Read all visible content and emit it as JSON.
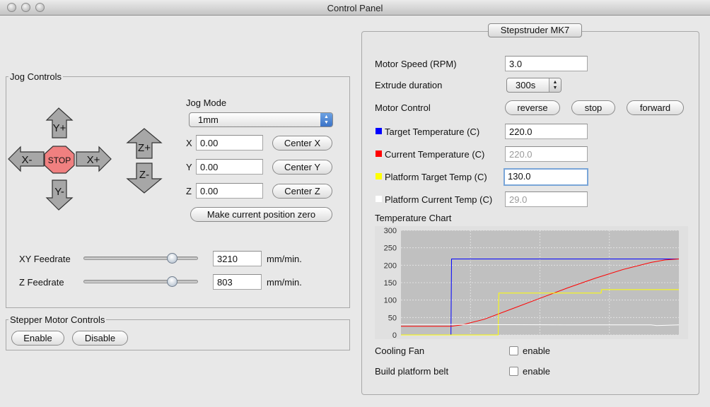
{
  "window": {
    "title": "Control Panel"
  },
  "jog": {
    "group_label": "Jog Controls",
    "buttons": {
      "y_plus": "Y+",
      "y_minus": "Y-",
      "x_plus": "X+",
      "x_minus": "X-",
      "stop": "STOP",
      "z_plus": "Z+",
      "z_minus": "Z-"
    },
    "mode_label": "Jog Mode",
    "mode_value": "1mm",
    "axes": [
      {
        "label": "X",
        "value": "0.00",
        "center": "Center X"
      },
      {
        "label": "Y",
        "value": "0.00",
        "center": "Center Y"
      },
      {
        "label": "Z",
        "value": "0.00",
        "center": "Center Z"
      }
    ],
    "make_zero": "Make current position zero",
    "xy_feed": {
      "label": "XY Feedrate",
      "value": "3210",
      "unit": "mm/min.",
      "level": 0.8
    },
    "z_feed": {
      "label": "Z Feedrate",
      "value": "803",
      "unit": "mm/min.",
      "level": 0.8
    }
  },
  "stepper": {
    "group_label": "Stepper Motor Controls",
    "enable": "Enable",
    "disable": "Disable"
  },
  "extruder": {
    "tab": "Stepstruder MK7",
    "motor_speed": {
      "label": "Motor Speed (RPM)",
      "value": "3.0"
    },
    "extrude_duration": {
      "label": "Extrude duration",
      "value": "300s"
    },
    "motor_control": {
      "label": "Motor Control",
      "reverse": "reverse",
      "stop": "stop",
      "forward": "forward"
    },
    "target_temp": {
      "label": "Target Temperature (C)",
      "value": "220.0",
      "color": "#0000ff"
    },
    "current_temp": {
      "label": "Current Temperature (C)",
      "value": "220.0",
      "color": "#ff0000"
    },
    "platform_target": {
      "label": "Platform Target Temp (C)",
      "value": "130.0",
      "color": "#ffff00"
    },
    "platform_current": {
      "label": "Platform Current Temp (C)",
      "value": "29.0",
      "color": "#ffffff"
    },
    "chart_label": "Temperature Chart",
    "cooling_fan": {
      "label": "Cooling Fan",
      "option": "enable",
      "checked": false
    },
    "build_belt": {
      "label": "Build platform belt",
      "option": "enable",
      "checked": false
    }
  },
  "chart_data": {
    "type": "line",
    "title": "",
    "xlabel": "",
    "ylabel": "",
    "ylim": [
      0,
      300
    ],
    "yticks": [
      "0",
      "25",
      "50",
      "75",
      "100",
      "125",
      "150",
      "175",
      "200",
      "225",
      "250",
      "275",
      "300"
    ],
    "xlim": [
      0,
      100
    ],
    "grid": true,
    "series": [
      {
        "color": "#0000ff",
        "x": [
          0,
          18,
          18,
          18.2,
          100
        ],
        "y": [
          0,
          0,
          5,
          218,
          218
        ]
      },
      {
        "color": "#ff0000",
        "x": [
          0,
          18,
          22,
          30,
          40,
          50,
          60,
          70,
          80,
          90,
          95,
          100
        ],
        "y": [
          25,
          25,
          29,
          45,
          75,
          105,
          135,
          163,
          188,
          208,
          215,
          218
        ]
      },
      {
        "color": "#ffff00",
        "x": [
          0,
          35,
          35.2,
          72,
          72.2,
          100
        ],
        "y": [
          0,
          0,
          120,
          120,
          130,
          130
        ]
      },
      {
        "color": "#ffffff",
        "x": [
          0,
          18,
          60,
          90,
          92,
          100
        ],
        "y": [
          30,
          30,
          29,
          29,
          27,
          29
        ]
      }
    ]
  }
}
